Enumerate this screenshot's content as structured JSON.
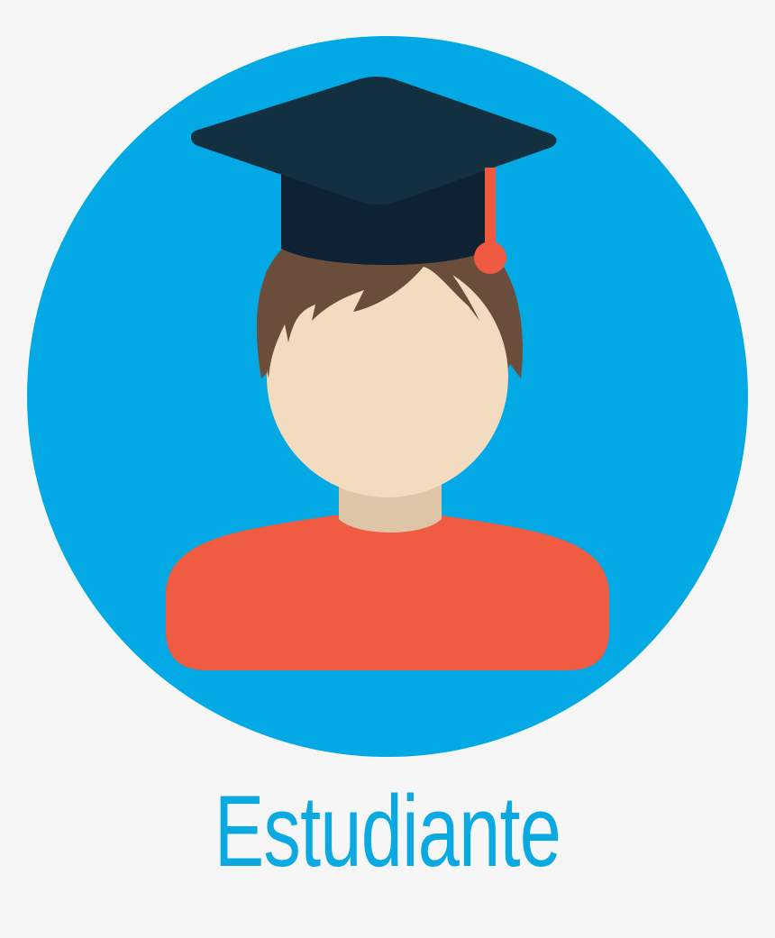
{
  "label": {
    "text": "Estudiante",
    "color": "#0aa9e1"
  },
  "colors": {
    "background": "#f6f6f6",
    "circle": "#03a9e4",
    "cap": "#12303f",
    "cap_band": "#0e2233",
    "tassel": "#ef5a40",
    "hair": "#6b4d3c",
    "face": "#f2dbbf",
    "neck": "#dfc5a8",
    "shirt": "#ef5c41"
  },
  "icon": "student-avatar-icon"
}
